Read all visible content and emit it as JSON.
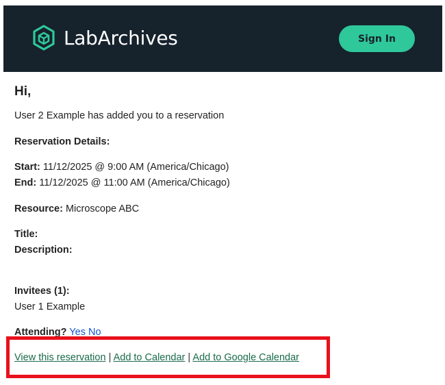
{
  "header": {
    "brand": "LabArchives",
    "sign_in_label": "Sign In",
    "icon": "cube-icon",
    "bg_color": "#16222c",
    "accent_color": "#2fc89a"
  },
  "email": {
    "greeting": "Hi,",
    "intro": "User 2 Example has added you to a reservation",
    "details_heading": "Reservation Details:",
    "start_label": "Start:",
    "start_value": "11/12/2025 @ 9:00 AM (America/Chicago)",
    "end_label": "End:",
    "end_value": "11/12/2025 @ 11:00 AM (America/Chicago)",
    "resource_label": "Resource:",
    "resource_value": "Microscope ABC",
    "title_label": "Title:",
    "description_label": "Description:",
    "invitees_label": "Invitees (1):",
    "invitees": [
      "User 1 Example"
    ],
    "attending_label": "Attending?",
    "attending_yes": "Yes",
    "attending_no": "No",
    "links": {
      "view_reservation": "View this reservation",
      "add_calendar": "Add to Calendar",
      "add_google_calendar": "Add to Google Calendar",
      "separator": "|"
    },
    "highlight_color": "#e8101c"
  }
}
